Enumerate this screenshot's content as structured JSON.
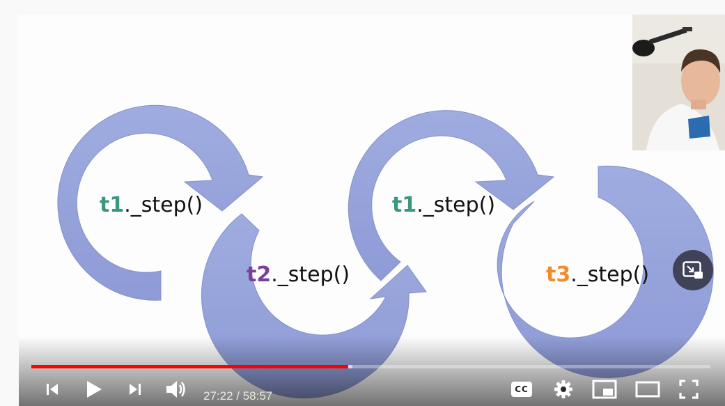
{
  "slide": {
    "labels": [
      {
        "thread": "t1",
        "call": "._step()",
        "color": "#3d9680"
      },
      {
        "thread": "t2",
        "call": "._step()",
        "color": "#7a3e9c"
      },
      {
        "thread": "t1",
        "call": "._step()",
        "color": "#3d9680"
      },
      {
        "thread": "t3",
        "call": "._step()",
        "color": "#ef8c2b"
      }
    ],
    "arrow_color": "#8c9bd8"
  },
  "player": {
    "progress_fraction": 0.467,
    "loaded_fraction": 0.473,
    "time_current": "27:22",
    "time_separator": " / ",
    "time_total": "58:57",
    "controls": [
      "previous-icon",
      "play-icon",
      "next-icon",
      "volume-icon",
      "captions-icon",
      "settings-icon",
      "miniplayer-icon",
      "theater-mode-icon",
      "fullscreen-icon"
    ],
    "captions_label": "CC",
    "accent_color": "#ff0000"
  }
}
